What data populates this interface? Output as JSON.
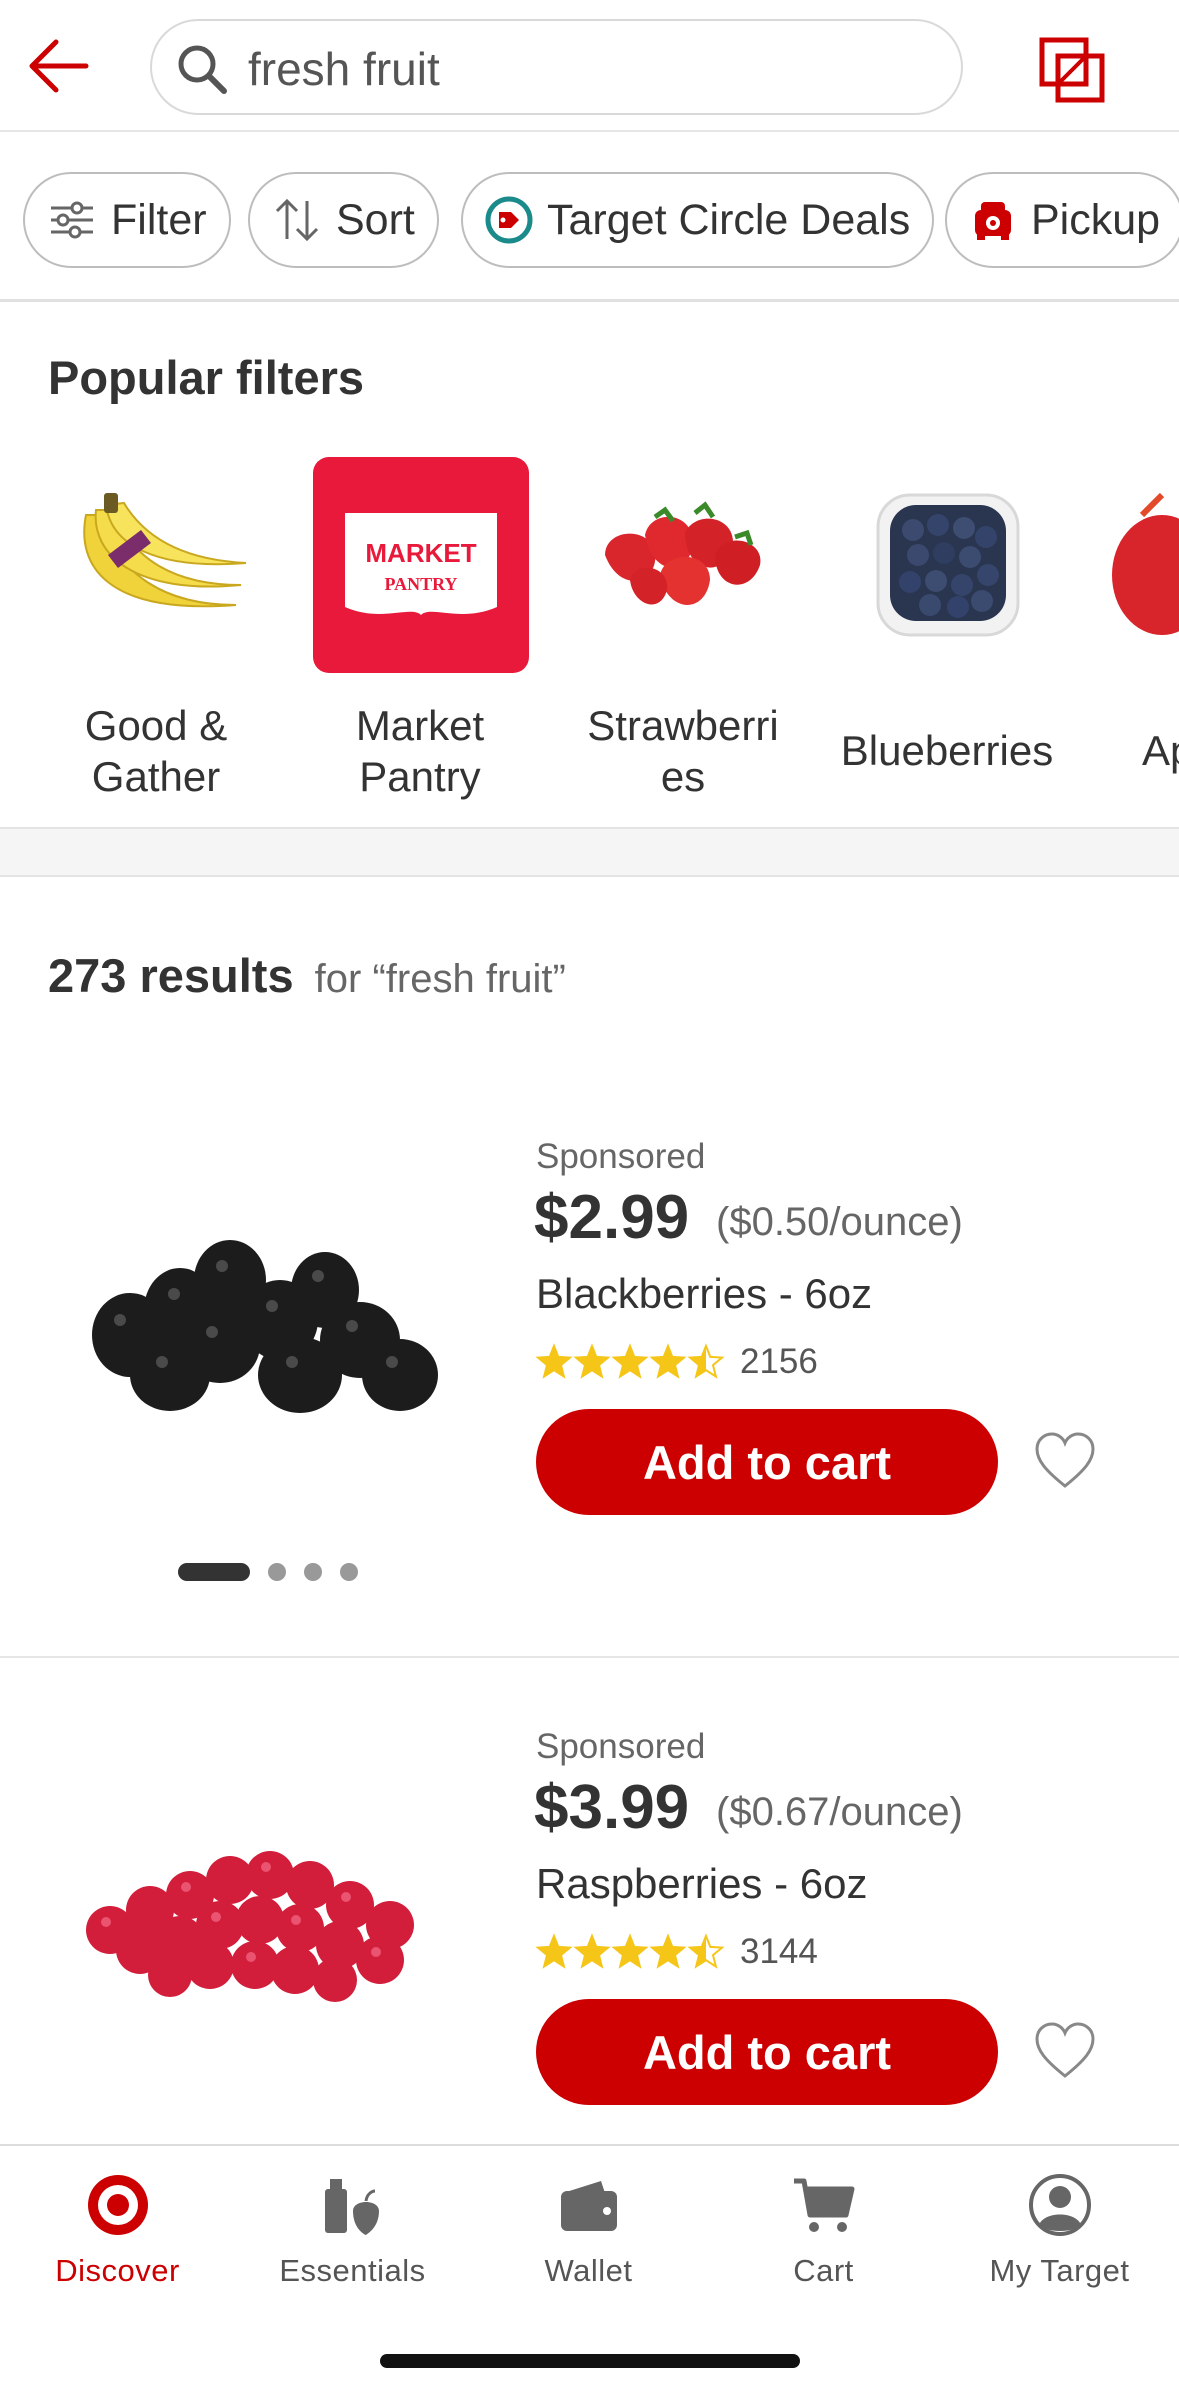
{
  "search": {
    "query": "fresh fruit"
  },
  "chips": [
    {
      "label": "Filter",
      "icon": "sliders-icon"
    },
    {
      "label": "Sort",
      "icon": "sort-arrows-icon"
    },
    {
      "label": "Target Circle Deals",
      "icon": "target-circle-tag-icon"
    },
    {
      "label": "Pickup",
      "icon": "pickup-car-icon"
    }
  ],
  "popular_filters": {
    "title": "Popular filters",
    "items": [
      {
        "label_line1": "Good &",
        "label_line2": "Gather",
        "image": "bananas-image"
      },
      {
        "label_line1": "Market",
        "label_line2": "Pantry",
        "image": "market-pantry-logo",
        "logo_line1": "MARKET",
        "logo_line2": "PANTRY"
      },
      {
        "label_line1": "Strawberri",
        "label_line2": "es",
        "image": "strawberries-image"
      },
      {
        "label_line1": "Blueberries",
        "label_line2": "",
        "image": "blueberries-image"
      },
      {
        "label_line1": "Ap",
        "label_line2": "",
        "image": "apples-image"
      }
    ]
  },
  "results": {
    "count": "273 results",
    "query_text": "for “fresh fruit”"
  },
  "products": [
    {
      "sponsored": "Sponsored",
      "price": "$2.99",
      "unit_price": "($0.50/ounce)",
      "name": "Blackberries - 6oz",
      "rating": 4.5,
      "review_count": "2156",
      "add_label": "Add to cart",
      "image": "blackberries-image"
    },
    {
      "sponsored": "Sponsored",
      "price": "$3.99",
      "unit_price": "($0.67/ounce)",
      "name": "Raspberries - 6oz",
      "rating": 4.5,
      "review_count": "3144",
      "add_label": "Add to cart",
      "image": "raspberries-image"
    }
  ],
  "bottom_nav": [
    {
      "label": "Discover",
      "icon": "target-logo-icon",
      "active": true
    },
    {
      "label": "Essentials",
      "icon": "essentials-icon"
    },
    {
      "label": "Wallet",
      "icon": "wallet-icon"
    },
    {
      "label": "Cart",
      "icon": "cart-icon"
    },
    {
      "label": "My Target",
      "icon": "account-icon"
    }
  ],
  "colors": {
    "accent": "#cc0000",
    "text": "#333333",
    "muted": "#666666",
    "star": "#f5c518"
  }
}
